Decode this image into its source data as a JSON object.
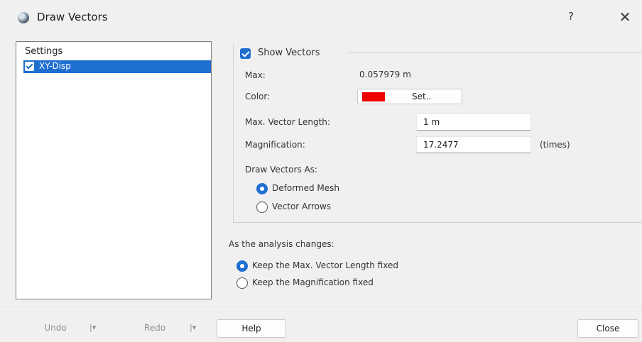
{
  "window": {
    "title": "Draw Vectors",
    "help_label": "?",
    "close_label": "✕"
  },
  "settings": {
    "header": "Settings",
    "items": [
      {
        "label": "XY-Disp",
        "checked": true,
        "selected": true
      }
    ]
  },
  "vectors": {
    "show_vectors_label": "Show Vectors",
    "max_label": "Max:",
    "max_value": "0.057979 m",
    "color_label": "Color:",
    "color_value": "#ee0000",
    "set_button_label": "Set..",
    "max_vector_length_label": "Max. Vector Length:",
    "max_vector_length_value": "1 m",
    "magnification_label": "Magnification:",
    "magnification_value": "17.2477",
    "magnification_unit": "(times)",
    "draw_as_label": "Draw Vectors As:",
    "draw_as_options": [
      {
        "label": "Deformed Mesh",
        "selected": true
      },
      {
        "label": "Vector Arrows",
        "selected": false
      }
    ]
  },
  "analysis": {
    "label": "As the analysis changes:",
    "options": [
      {
        "label": "Keep the Max. Vector Length fixed",
        "selected": true
      },
      {
        "label": "Keep the Magnification fixed",
        "selected": false
      }
    ]
  },
  "footer": {
    "undo_label": "Undo",
    "redo_label": "Redo",
    "dropdown_glyph": "|▾",
    "help_label": "Help",
    "close_label": "Close"
  },
  "colors": {
    "accent": "#1f6fd1"
  }
}
